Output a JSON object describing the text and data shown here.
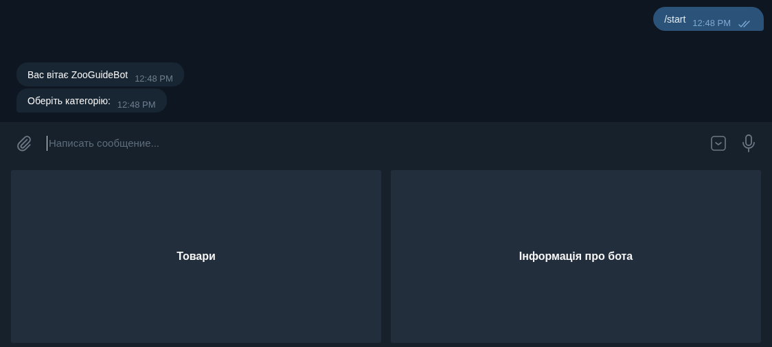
{
  "messages": [
    {
      "kind": "outgoing",
      "text": "/start",
      "time": "12:48 PM",
      "read": true
    },
    {
      "kind": "incoming",
      "text": "Вас вітає ZooGuideBot",
      "time": "12:48 PM"
    },
    {
      "kind": "incoming",
      "text": "Оберіть категорію:",
      "time": "12:48 PM"
    }
  ],
  "composer": {
    "placeholder": "Написать сообщение..."
  },
  "keyboard": [
    "Товари",
    "Інформація про бота"
  ]
}
